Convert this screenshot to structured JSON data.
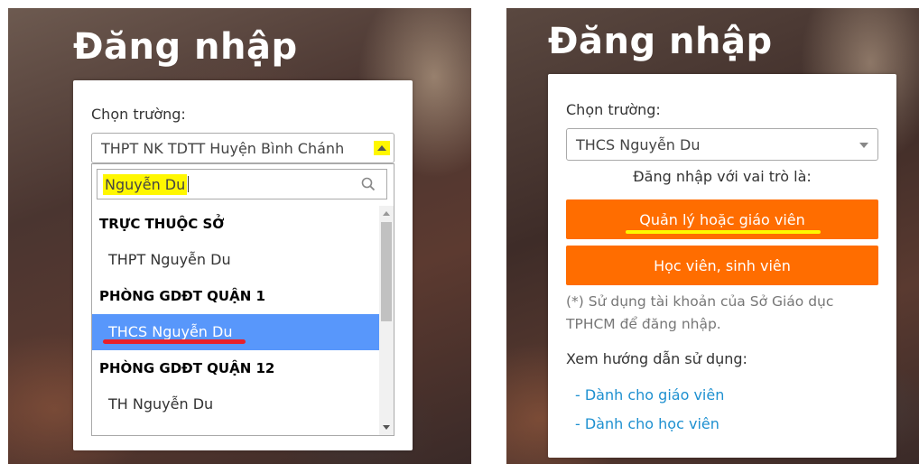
{
  "left": {
    "title": "Đăng nhập",
    "school_label": "Chọn trường:",
    "selected_school": "THPT NK TDTT Huyện Bình Chánh",
    "search_value": "Nguyễn Du",
    "options": [
      {
        "type": "group",
        "label": "TRỰC THUỘC SỞ"
      },
      {
        "type": "option",
        "label": "THPT Nguyễn Du"
      },
      {
        "type": "group",
        "label": "PHÒNG GDĐT QUẬN 1"
      },
      {
        "type": "option",
        "label": "THCS Nguyễn Du",
        "selected": true
      },
      {
        "type": "group",
        "label": "PHÒNG GDĐT QUẬN 12"
      },
      {
        "type": "option",
        "label": "TH Nguyễn Du"
      }
    ]
  },
  "right": {
    "title": "Đăng nhập",
    "school_label": "Chọn trường:",
    "selected_school": "THCS Nguyễn Du",
    "role_label": "Đăng nhập với vai trò là:",
    "btn_teacher": "Quản lý hoặc giáo viên",
    "btn_student": "Học viên, sinh viên",
    "note": "(*) Sử dụng tài khoản của Sở Giáo dục TPHCM để đăng nhập.",
    "guide_label": "Xem hướng dẫn sử dụng:",
    "link_teacher": "- Dành cho giáo viên",
    "link_student": "- Dành cho học viên"
  },
  "colors": {
    "orange": "#ff6d00",
    "highlight_yellow": "#fff700",
    "selected_blue": "#5897fb",
    "link_blue": "#1e90d0",
    "underline_red": "#e8202a"
  }
}
